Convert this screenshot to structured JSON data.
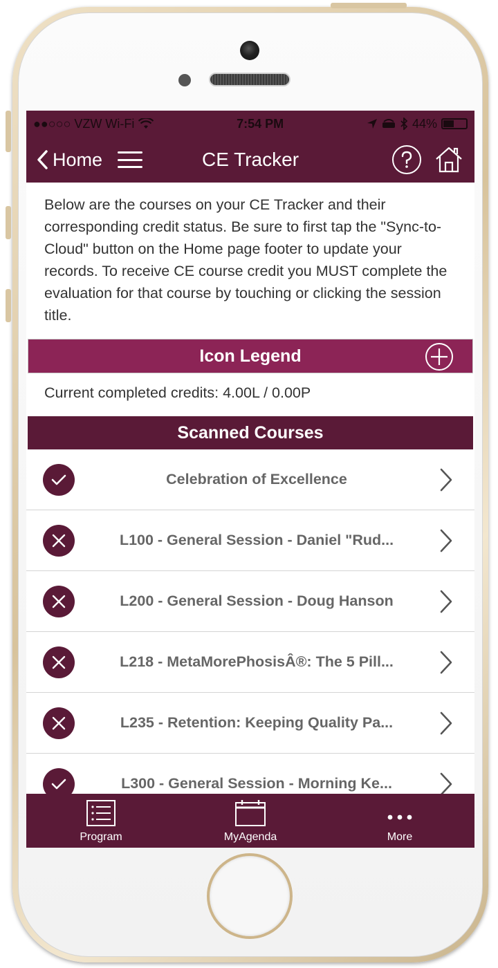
{
  "status_bar": {
    "carrier": "●●○○○ VZW Wi-Fi",
    "time": "7:54 PM",
    "battery": "44%"
  },
  "nav": {
    "back_label": "Home",
    "title": "CE Tracker"
  },
  "intro_text": "Below are the courses on your CE Tracker and their corresponding credit status. Be sure to first tap the \"Sync-to-Cloud\" button on the Home page footer to update your records. To receive CE course credit you MUST complete the evaluation for that course by touching or clicking the session title.",
  "legend": {
    "title": "Icon Legend"
  },
  "credits": "Current completed credits: 4.00L / 0.00P",
  "scanned": {
    "title": "Scanned Courses"
  },
  "courses": [
    {
      "title": "Celebration of Excellence",
      "status": "completed"
    },
    {
      "title": "L100 - General Session - Daniel \"Rud...",
      "status": "incomplete"
    },
    {
      "title": "L200 - General Session - Doug Hanson",
      "status": "incomplete"
    },
    {
      "title": "L218 - MetaMorePhosisÂ®: The 5 Pill...",
      "status": "incomplete"
    },
    {
      "title": "L235 - Retention: Keeping Quality Pa...",
      "status": "incomplete"
    },
    {
      "title": "L300 - General Session - Morning Ke...",
      "status": "completed"
    }
  ],
  "tabs": [
    {
      "label": "Program",
      "icon": "list-icon"
    },
    {
      "label": "MyAgenda",
      "icon": "calendar-icon"
    },
    {
      "label": "More",
      "icon": "more-icon"
    }
  ],
  "colors": {
    "primary": "#5a1a37",
    "legend": "#8c2456"
  }
}
